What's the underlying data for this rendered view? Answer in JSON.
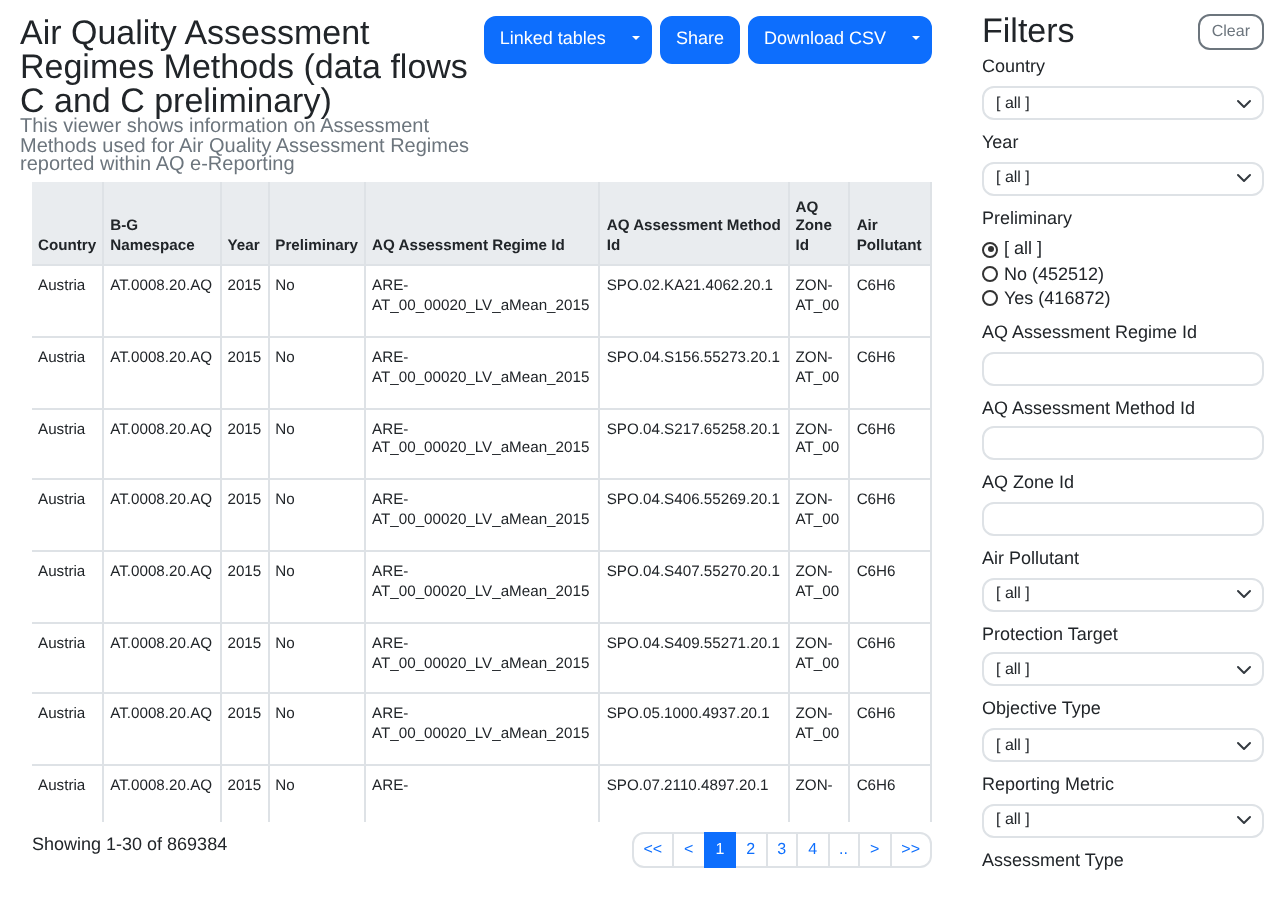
{
  "header": {
    "title": "Air Quality Assessment Regimes Methods (data flows C and C preliminary)",
    "description": "This viewer shows information on Assessment Methods used for Air Quality Assessment Regimes reported within AQ e-Reporting",
    "buttons": [
      {
        "label": "Linked tables",
        "dropdown": true
      },
      {
        "label": "Share",
        "dropdown": false
      },
      {
        "label": "Download CSV",
        "dropdown": true
      }
    ]
  },
  "table": {
    "columns": [
      "Country",
      "B-G Namespace",
      "Year",
      "Preliminary",
      "AQ Assessment Regime Id",
      "AQ Assessment Method Id",
      "AQ Zone Id",
      "Air Pollutant"
    ],
    "rows": [
      [
        "Austria",
        "AT.0008.20.AQ",
        "2015",
        "No",
        "ARE-AT_00_00020_LV_aMean_2015",
        "SPO.02.KA21.4062.20.1",
        "ZON-AT_00",
        "C6H6"
      ],
      [
        "Austria",
        "AT.0008.20.AQ",
        "2015",
        "No",
        "ARE-AT_00_00020_LV_aMean_2015",
        "SPO.04.S156.55273.20.1",
        "ZON-AT_00",
        "C6H6"
      ],
      [
        "Austria",
        "AT.0008.20.AQ",
        "2015",
        "No",
        "ARE-AT_00_00020_LV_aMean_2015",
        "SPO.04.S217.65258.20.1",
        "ZON-AT_00",
        "C6H6"
      ],
      [
        "Austria",
        "AT.0008.20.AQ",
        "2015",
        "No",
        "ARE-AT_00_00020_LV_aMean_2015",
        "SPO.04.S406.55269.20.1",
        "ZON-AT_00",
        "C6H6"
      ],
      [
        "Austria",
        "AT.0008.20.AQ",
        "2015",
        "No",
        "ARE-AT_00_00020_LV_aMean_2015",
        "SPO.04.S407.55270.20.1",
        "ZON-AT_00",
        "C6H6"
      ],
      [
        "Austria",
        "AT.0008.20.AQ",
        "2015",
        "No",
        "ARE-AT_00_00020_LV_aMean_2015",
        "SPO.04.S409.55271.20.1",
        "ZON-AT_00",
        "C6H6"
      ],
      [
        "Austria",
        "AT.0008.20.AQ",
        "2015",
        "No",
        "ARE-AT_00_00020_LV_aMean_2015",
        "SPO.05.1000.4937.20.1",
        "ZON-AT_00",
        "C6H6"
      ],
      [
        "Austria",
        "AT.0008.20.AQ",
        "2015",
        "No",
        "ARE-",
        "SPO.07.2110.4897.20.1",
        "ZON-",
        "C6H6"
      ]
    ]
  },
  "footer": {
    "summary": "Showing 1-30 of 869384",
    "pages": [
      {
        "label": "<<",
        "selected": false
      },
      {
        "label": "<",
        "selected": false
      },
      {
        "label": "1",
        "selected": true
      },
      {
        "label": "2",
        "selected": false
      },
      {
        "label": "3",
        "selected": false
      },
      {
        "label": "4",
        "selected": false
      },
      {
        "label": "..",
        "selected": false
      },
      {
        "label": ">",
        "selected": false
      },
      {
        "label": ">>",
        "selected": false
      }
    ]
  },
  "filters": {
    "title": "Filters",
    "clear_button": "Clear",
    "items": [
      {
        "kind": "select",
        "label": "Country",
        "value": "[ all ]"
      },
      {
        "kind": "select",
        "label": "Year",
        "value": "[ all ]"
      },
      {
        "kind": "radio",
        "label": "Preliminary",
        "options": [
          {
            "label": "[ all ]",
            "selected": true
          },
          {
            "label": "No (452512)",
            "selected": false
          },
          {
            "label": "Yes (416872)",
            "selected": false
          }
        ]
      },
      {
        "kind": "text",
        "label": "AQ Assessment Regime Id"
      },
      {
        "kind": "text",
        "label": "AQ Assessment Method Id"
      },
      {
        "kind": "text",
        "label": "AQ Zone Id"
      },
      {
        "kind": "select",
        "label": "Air Pollutant",
        "value": "[ all ]"
      },
      {
        "kind": "select",
        "label": "Protection Target",
        "value": "[ all ]"
      },
      {
        "kind": "select",
        "label": "Objective Type",
        "value": "[ all ]"
      },
      {
        "kind": "select",
        "label": "Reporting Metric",
        "value": "[ all ]"
      },
      {
        "kind": "label",
        "label": "Assessment Type"
      }
    ]
  }
}
